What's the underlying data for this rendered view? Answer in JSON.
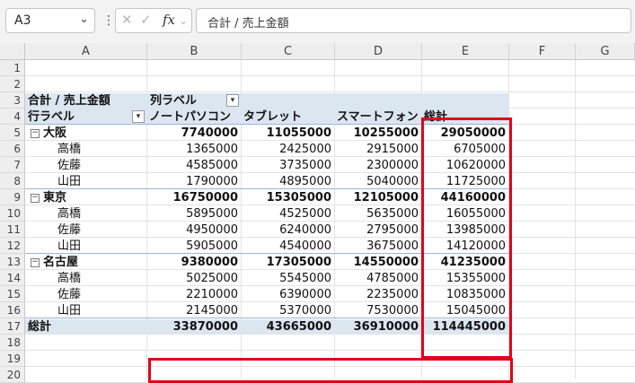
{
  "formula_bar": {
    "name_box": "A3",
    "formula": "合計 / 売上金額",
    "cancel_glyph": "✕",
    "confirm_glyph": "✓",
    "fx_label": "fx"
  },
  "columns": [
    "A",
    "B",
    "C",
    "D",
    "E",
    "F",
    "G"
  ],
  "rows": [
    "1",
    "2",
    "3",
    "4",
    "5",
    "6",
    "7",
    "8",
    "9",
    "10",
    "11",
    "12",
    "13",
    "14",
    "15",
    "16",
    "17",
    "18",
    "19",
    "20"
  ],
  "pivot": {
    "corner_label": "合計 / 売上金額",
    "col_field_label": "列ラベル",
    "row_field_label": "行ラベル",
    "col_headers": [
      "ノートパソコン",
      "タブレット",
      "スマートフォン",
      "総計"
    ],
    "groups": [
      {
        "name": "大阪",
        "totals": [
          "7740000",
          "11055000",
          "10255000",
          "29050000"
        ],
        "rows": [
          {
            "name": "高橋",
            "values": [
              "1365000",
              "2425000",
              "2915000",
              "6705000"
            ]
          },
          {
            "name": "佐藤",
            "values": [
              "4585000",
              "3735000",
              "2300000",
              "10620000"
            ]
          },
          {
            "name": "山田",
            "values": [
              "1790000",
              "4895000",
              "5040000",
              "11725000"
            ]
          }
        ]
      },
      {
        "name": "東京",
        "totals": [
          "16750000",
          "15305000",
          "12105000",
          "44160000"
        ],
        "rows": [
          {
            "name": "高橋",
            "values": [
              "5895000",
              "4525000",
              "5635000",
              "16055000"
            ]
          },
          {
            "name": "佐藤",
            "values": [
              "4950000",
              "6240000",
              "2795000",
              "13985000"
            ]
          },
          {
            "name": "山田",
            "values": [
              "5905000",
              "4540000",
              "3675000",
              "14120000"
            ]
          }
        ]
      },
      {
        "name": "名古屋",
        "totals": [
          "9380000",
          "17305000",
          "14550000",
          "41235000"
        ],
        "rows": [
          {
            "name": "高橋",
            "values": [
              "5025000",
              "5545000",
              "4785000",
              "15355000"
            ]
          },
          {
            "name": "佐藤",
            "values": [
              "2210000",
              "6390000",
              "2235000",
              "10835000"
            ]
          },
          {
            "name": "山田",
            "values": [
              "2145000",
              "5370000",
              "7530000",
              "15045000"
            ]
          }
        ]
      }
    ],
    "grand_total": {
      "label": "総計",
      "values": [
        "33870000",
        "43665000",
        "36910000",
        "114445000"
      ]
    }
  },
  "highlight_color": "#e0001b",
  "pivot_band_color": "#dce6f1"
}
